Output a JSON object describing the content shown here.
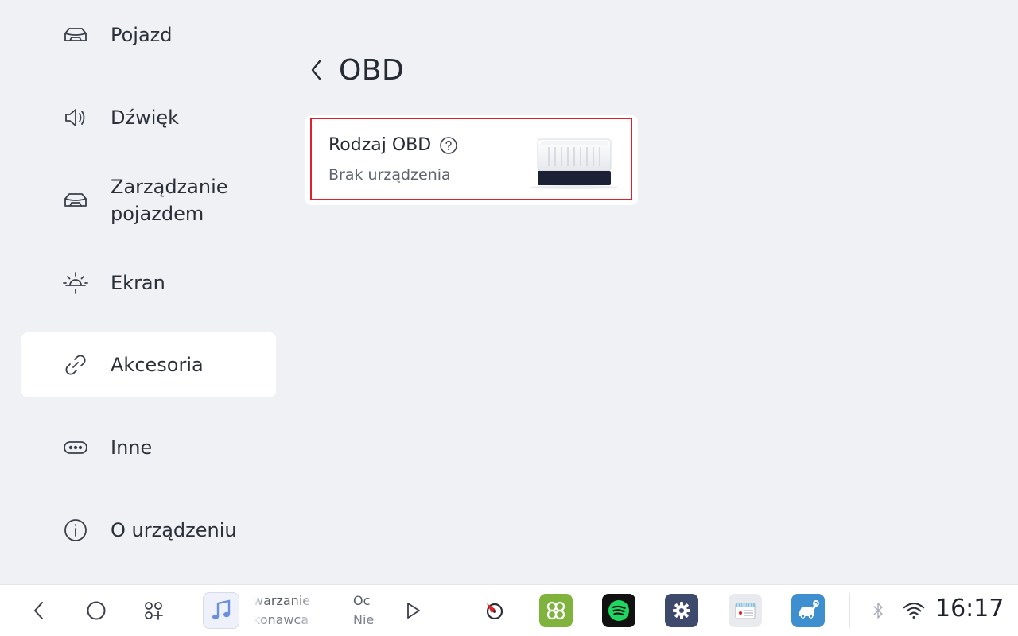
{
  "sidebar": {
    "items": [
      {
        "label": "Pojazd",
        "icon": "car-icon"
      },
      {
        "label": "Dźwięk",
        "icon": "speaker-icon"
      },
      {
        "label": "Zarządzanie pojazdem",
        "icon": "car-manage-icon"
      },
      {
        "label": "Ekran",
        "icon": "brightness-icon"
      },
      {
        "label": "Akcesoria",
        "icon": "link-icon",
        "active": true
      },
      {
        "label": "Inne",
        "icon": "more-icon"
      },
      {
        "label": "O urządzeniu",
        "icon": "info-icon"
      }
    ]
  },
  "page": {
    "title": "OBD"
  },
  "obd_card": {
    "title": "Rodzaj OBD",
    "status": "Brak urządzenia"
  },
  "taskbar": {
    "music": {
      "title_1": "warzanie",
      "subtitle_1": "konawca",
      "title_2": "Oc",
      "subtitle_2": "Nie"
    },
    "time": "16:17",
    "apps": [
      "navigation-icon",
      "grid-apps-icon",
      "spotify-icon",
      "settings-gear-icon",
      "radio-icon",
      "car-service-icon"
    ]
  },
  "colors": {
    "background": "#eff1f5",
    "card": "#ffffff",
    "highlight": "#e0202a",
    "spotify": "#1ed760"
  }
}
